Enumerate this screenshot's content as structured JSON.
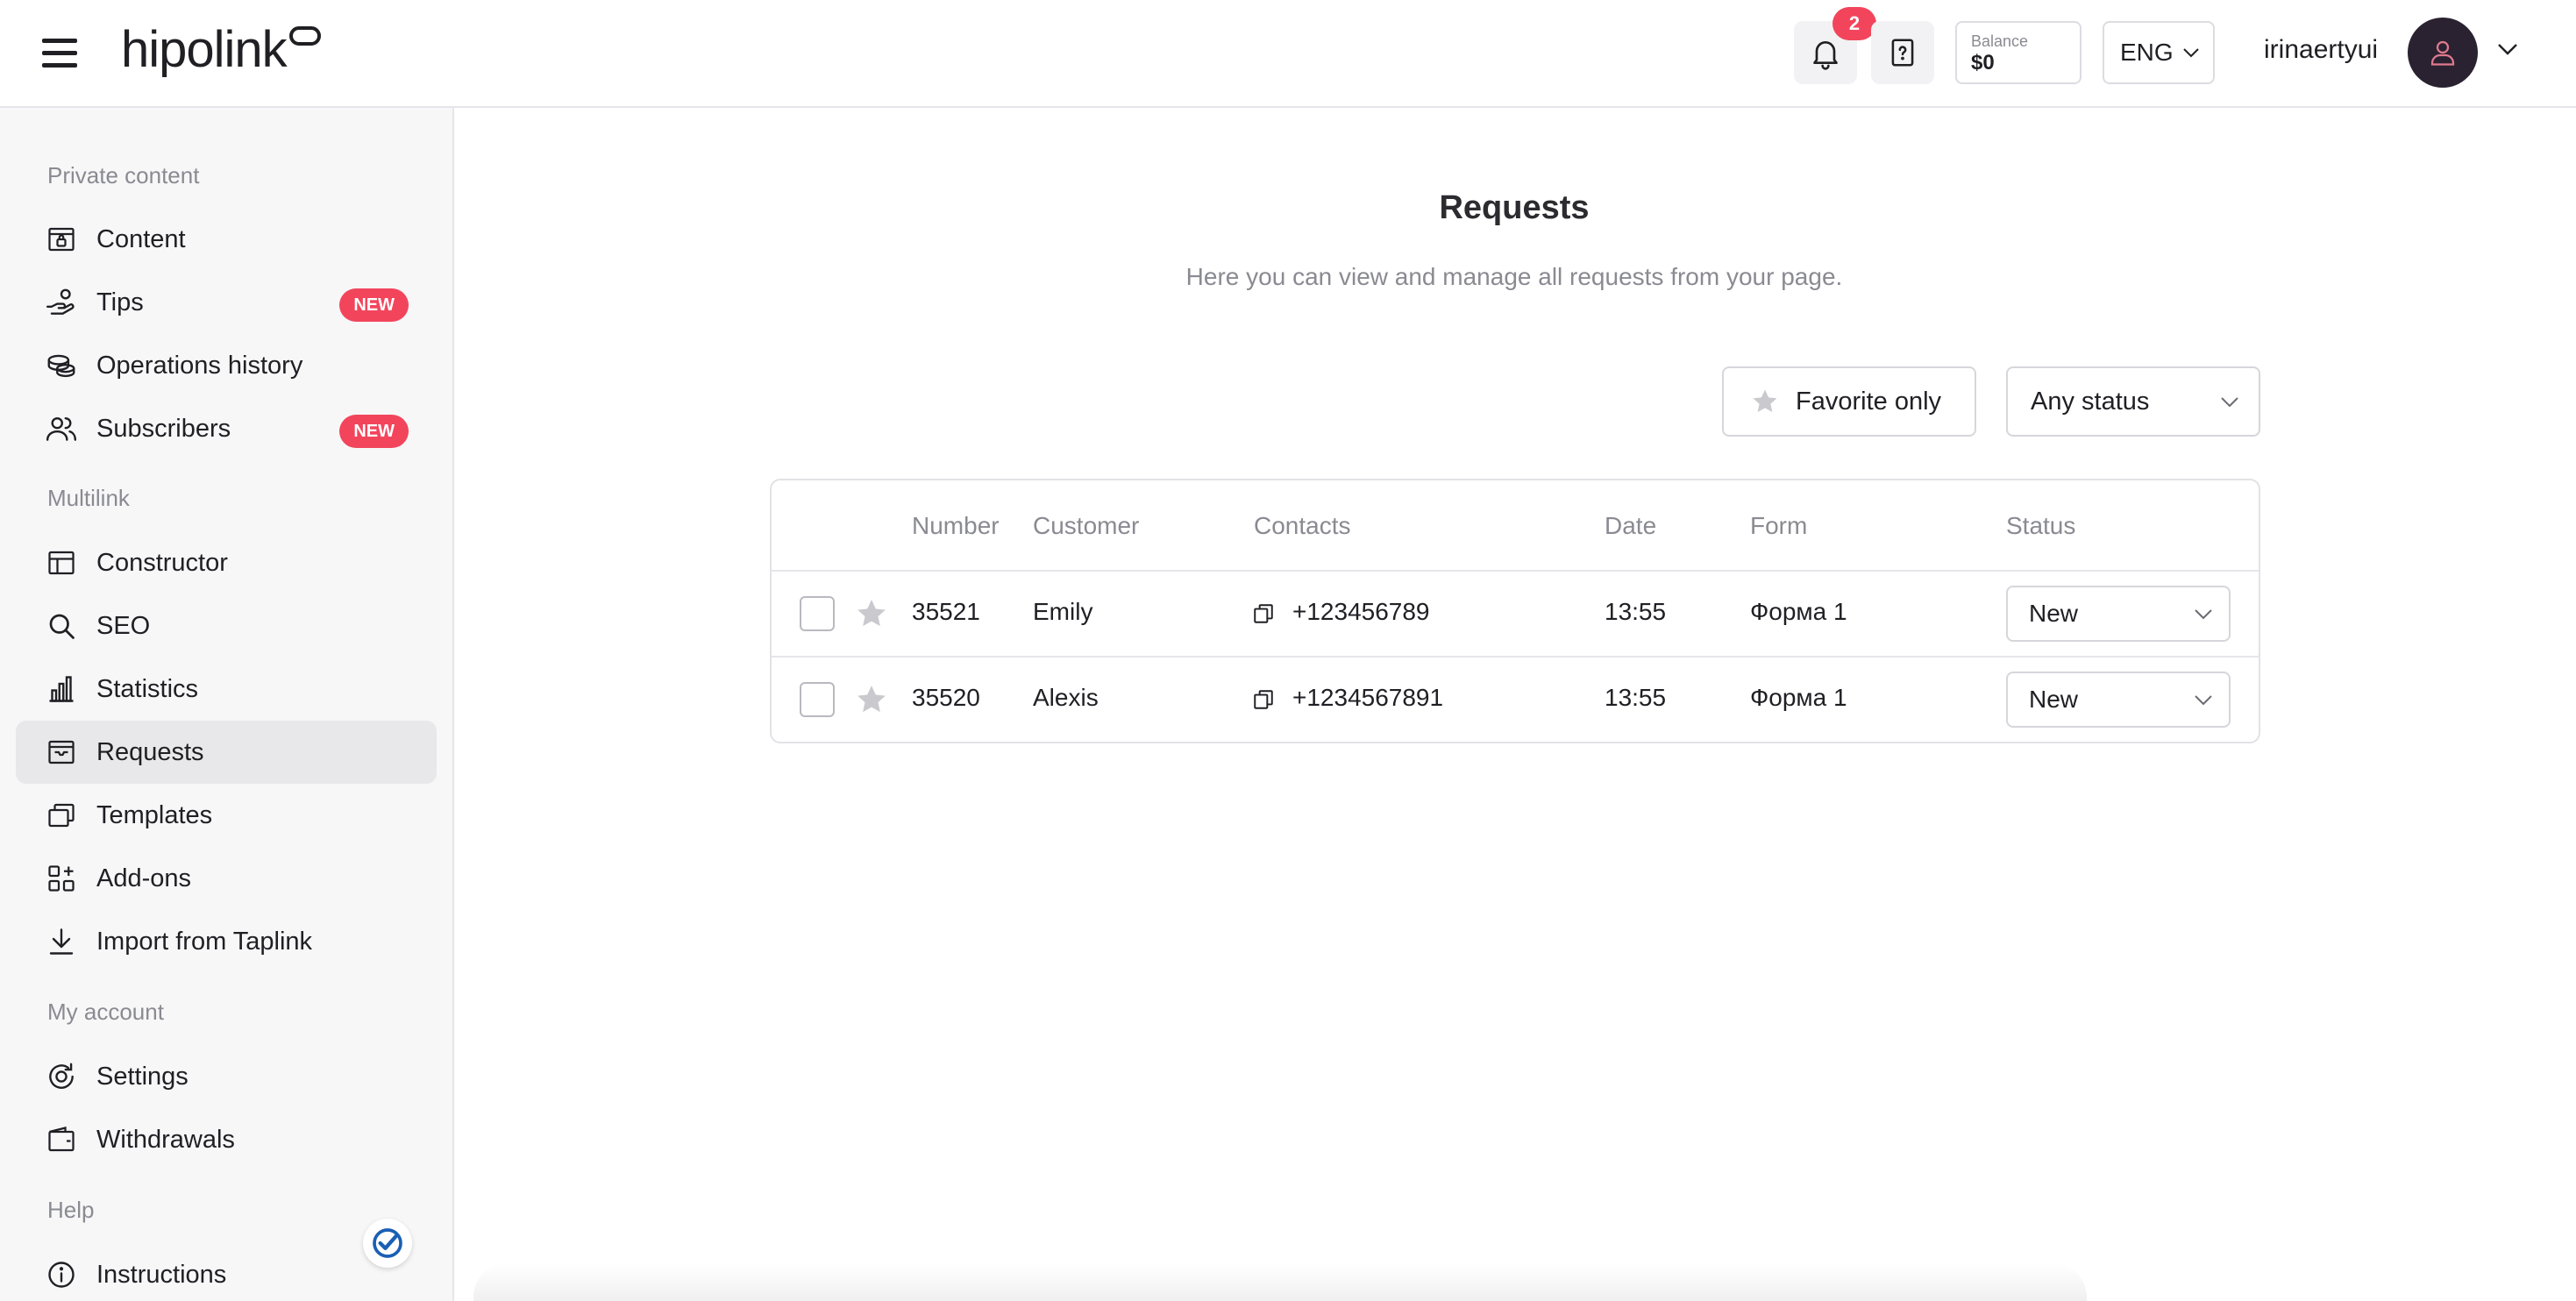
{
  "header": {
    "logo_text": "hipolink",
    "notification_count": "2",
    "balance_label": "Balance",
    "balance_value": "$0",
    "language": "ENG",
    "username": "irinaertyui"
  },
  "sidebar": {
    "sections": [
      {
        "title": "Private content"
      },
      {
        "title": "Multilink"
      },
      {
        "title": "My account"
      },
      {
        "title": "Help"
      }
    ],
    "items": [
      {
        "label": "Content",
        "icon": "content-icon"
      },
      {
        "label": "Tips",
        "icon": "tips-hand-icon",
        "badge": "NEW"
      },
      {
        "label": "Operations history",
        "icon": "coins-icon"
      },
      {
        "label": "Subscribers",
        "icon": "users-icon",
        "badge": "NEW"
      },
      {
        "label": "Constructor",
        "icon": "layout-icon"
      },
      {
        "label": "SEO",
        "icon": "search-icon"
      },
      {
        "label": "Statistics",
        "icon": "bar-chart-icon"
      },
      {
        "label": "Requests",
        "icon": "inbox-icon",
        "active": true
      },
      {
        "label": "Templates",
        "icon": "templates-icon"
      },
      {
        "label": "Add-ons",
        "icon": "grid-plus-icon"
      },
      {
        "label": "Import from Taplink",
        "icon": "download-icon"
      },
      {
        "label": "Settings",
        "icon": "settings-icon"
      },
      {
        "label": "Withdrawals",
        "icon": "wallet-icon"
      },
      {
        "label": "Instructions",
        "icon": "info-icon"
      }
    ]
  },
  "main": {
    "title": "Requests",
    "subtitle": "Here you can view and manage all requests from your page.",
    "favorite_label": "Favorite only",
    "status_filter": "Any status",
    "table": {
      "columns": [
        "Number",
        "Customer",
        "Contacts",
        "Date",
        "Form",
        "Status"
      ],
      "rows": [
        {
          "number": "35521",
          "customer": "Emily",
          "contact": "+123456789",
          "date": "13:55",
          "form": "Форма 1",
          "status": "New"
        },
        {
          "number": "35520",
          "customer": "Alexis",
          "contact": "+1234567891",
          "date": "13:55",
          "form": "Форма 1",
          "status": "New"
        }
      ]
    }
  },
  "colors": {
    "accent_badge": "#f2455c",
    "avatar_bg": "#2a2231",
    "active_nav_bg": "#e8e8ea"
  }
}
